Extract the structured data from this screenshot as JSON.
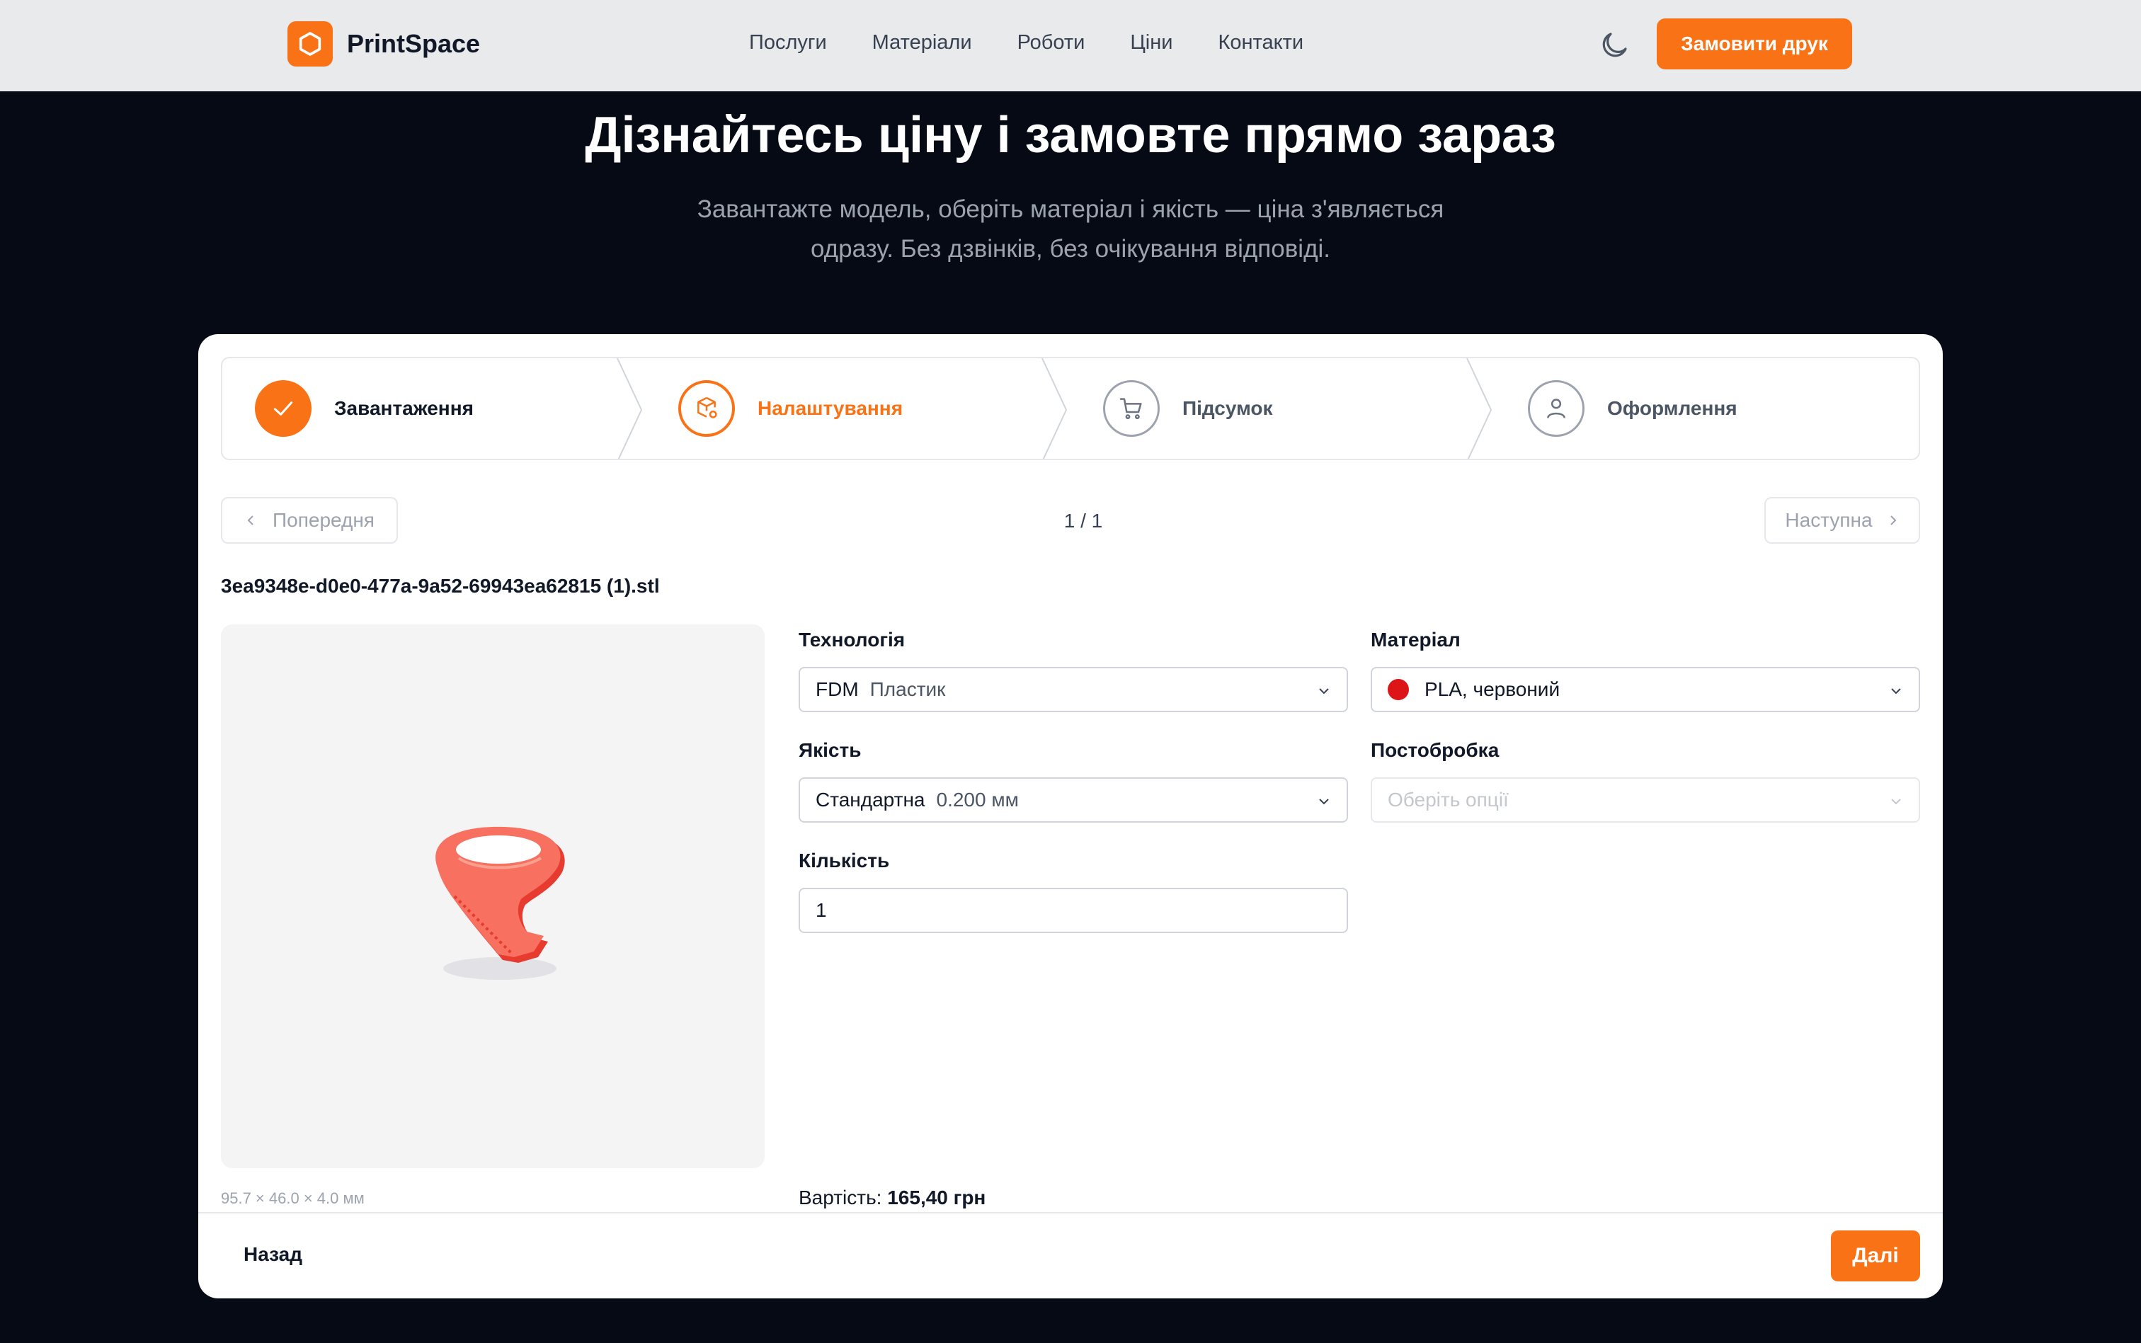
{
  "header": {
    "brand": "PrintSpace",
    "nav": [
      "Послуги",
      "Матеріали",
      "Роботи",
      "Ціни",
      "Контакти"
    ],
    "order_button": "Замовити друк",
    "theme_icon": "moon-icon"
  },
  "hero": {
    "title": "Дізнайтесь ціну і замовте прямо зараз",
    "subtitle_line1": "Завантажте модель, оберіть матеріал і якість — ціна з'являється",
    "subtitle_line2": "одразу. Без дзвінків, без очікування відповіді."
  },
  "steps": [
    {
      "label": "Завантаження",
      "state": "done",
      "icon": "check-icon"
    },
    {
      "label": "Налаштування",
      "state": "active",
      "icon": "box-settings-icon"
    },
    {
      "label": "Підсумок",
      "state": "idle",
      "icon": "cart-icon"
    },
    {
      "label": "Оформлення",
      "state": "idle",
      "icon": "user-icon"
    }
  ],
  "pager": {
    "prev": "Попередня",
    "next": "Наступна",
    "count": "1 / 1"
  },
  "file": {
    "name": "3ea9348e-d0e0-477a-9a52-69943ea62815 (1).stl",
    "dimensions": "95.7 × 46.0 × 4.0 мм",
    "model_color": "#f87060"
  },
  "form": {
    "technology_label": "Технологія",
    "technology_value": "FDM",
    "technology_detail": "Пластик",
    "material_label": "Матеріал",
    "material_value": "PLA, червоний",
    "material_color": "#dc1616",
    "quality_label": "Якість",
    "quality_value": "Стандартна",
    "quality_detail": "0.200 мм",
    "postprocess_label": "Постобробка",
    "postprocess_placeholder": "Оберіть опції",
    "quantity_label": "Кількість",
    "quantity_value": "1"
  },
  "price": {
    "label": "Вартість:",
    "value": "165,40 грн"
  },
  "footer": {
    "back": "Назад",
    "next": "Далі"
  },
  "colors": {
    "accent": "#f97316",
    "background": "#060a15"
  }
}
